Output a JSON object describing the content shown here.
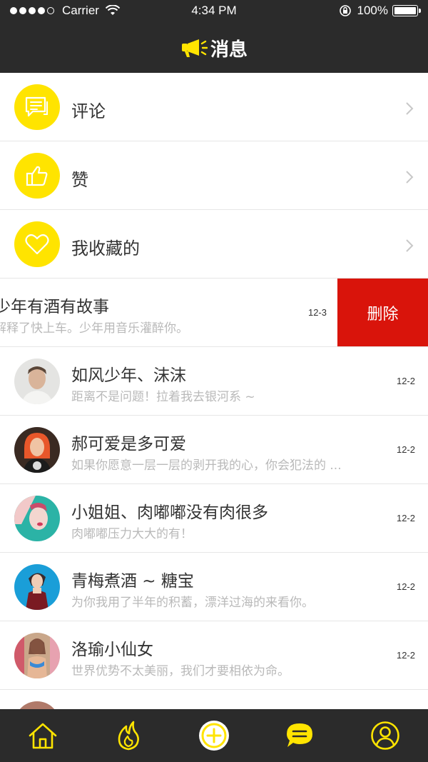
{
  "status_bar": {
    "carrier": "Carrier",
    "time": "4:34 PM",
    "battery": "100%"
  },
  "nav": {
    "title": "消息",
    "icon": "megaphone-icon"
  },
  "menu": [
    {
      "label": "评论",
      "icon": "comment-icon"
    },
    {
      "label": "赞",
      "icon": "thumbs-up-icon"
    },
    {
      "label": "我收藏的",
      "icon": "heart-icon"
    }
  ],
  "swiped_message": {
    "name": "少年有酒有故事",
    "preview": "解释了快上车。少年用音乐灌醉你。",
    "date": "12-3",
    "delete_label": "删除"
  },
  "messages": [
    {
      "name": "如风少年、沫沫",
      "preview": "距离不是问题！拉着我去银河系 ~",
      "date": "12-2"
    },
    {
      "name": "郝可爱是多可爱",
      "preview": "如果你愿意一层一层的剥开我的心，你会犯法的 ...",
      "date": "12-2"
    },
    {
      "name": "小姐姐、肉嘟嘟没有肉很多",
      "preview": "肉嘟嘟压力大大的有！",
      "date": "12-2"
    },
    {
      "name": "青梅煮酒 ~ 糖宝",
      "preview": "为你我用了半年的积蓄，漂洋过海的来看你。",
      "date": "12-2"
    },
    {
      "name": "洛瑜小仙女",
      "preview": "世界优势不太美丽，我们才要相依为命。",
      "date": "12-2"
    }
  ],
  "tabs": [
    {
      "icon": "home-icon"
    },
    {
      "icon": "flame-icon"
    },
    {
      "icon": "add-icon"
    },
    {
      "icon": "message-icon"
    },
    {
      "icon": "profile-icon"
    }
  ],
  "colors": {
    "accent": "#ffe400",
    "dark": "#2b2b2b",
    "delete": "#d9140b"
  }
}
